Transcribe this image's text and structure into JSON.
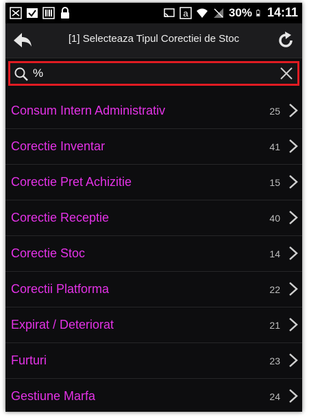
{
  "status": {
    "battery": "30%",
    "time": "14:11"
  },
  "header": {
    "title": "[1] Selecteaza Tipul Corectiei de Stoc"
  },
  "search": {
    "value": "%"
  },
  "items": [
    {
      "label": "Consum Intern Administrativ",
      "count": "25"
    },
    {
      "label": "Corectie Inventar",
      "count": "41"
    },
    {
      "label": "Corectie Pret Achizitie",
      "count": "15"
    },
    {
      "label": "Corectie Receptie",
      "count": "40"
    },
    {
      "label": "Corectie Stoc",
      "count": "14"
    },
    {
      "label": "Corectii Platforma",
      "count": "22"
    },
    {
      "label": "Expirat / Deteriorat",
      "count": "21"
    },
    {
      "label": "Furturi",
      "count": "23"
    },
    {
      "label": "Gestiune Marfa",
      "count": "24"
    }
  ],
  "colors": {
    "item_text": "#e332e6",
    "search_border": "#e01b22",
    "background": "#0d0d0f"
  }
}
